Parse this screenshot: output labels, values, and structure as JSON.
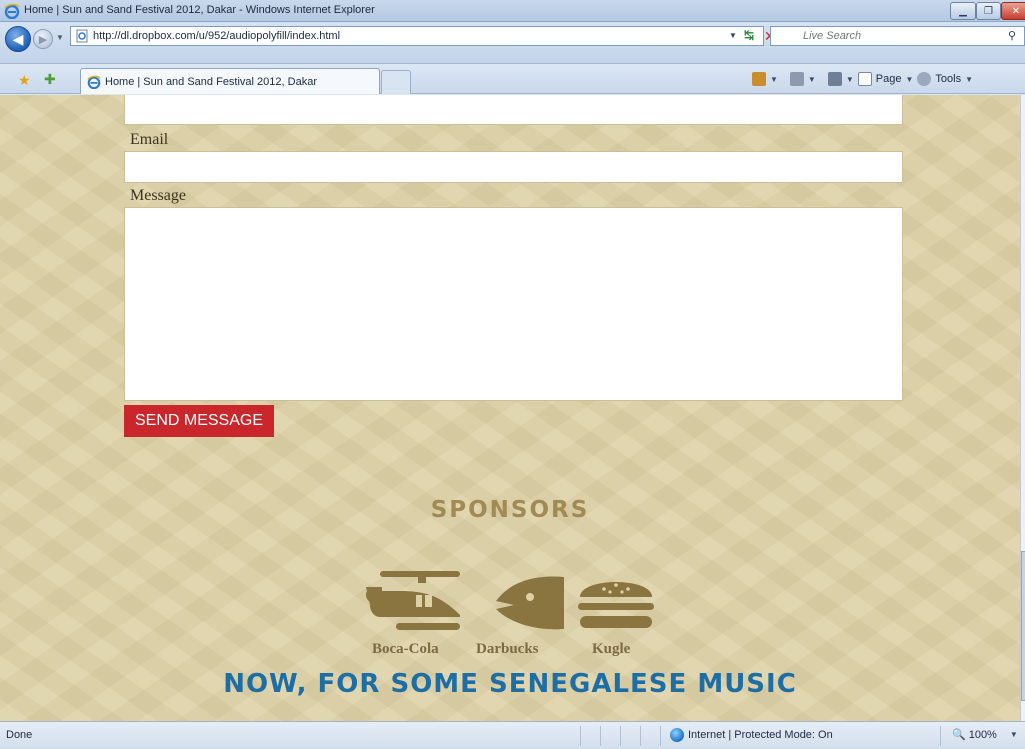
{
  "window": {
    "title": "Home | Sun and Sand Festival 2012, Dakar - Windows Internet Explorer"
  },
  "address_bar": {
    "url": "http://dl.dropbox.com/u/952/audiopolyfill/index.html",
    "search_placeholder": "Live Search"
  },
  "tabs": [
    {
      "label": "Home | Sun and Sand Festival 2012, Dakar"
    }
  ],
  "command_bar": {
    "page_label": "Page",
    "tools_label": "Tools"
  },
  "form": {
    "email_label": "Email",
    "message_label": "Message",
    "send_button_label": "SEND MESSAGE"
  },
  "sponsors": {
    "heading": "SPONSORS",
    "items": [
      {
        "name": "Boca-Cola",
        "icon": "helicopter-icon"
      },
      {
        "name": "Darbucks",
        "icon": "fish-icon"
      },
      {
        "name": "Kugle",
        "icon": "burger-icon"
      }
    ]
  },
  "music_heading": "NOW, FOR SOME SENEGALESE MUSIC",
  "status_bar": {
    "status": "Done",
    "zone": "Internet | Protected Mode: On",
    "zoom": "100%"
  },
  "colors": {
    "page_background": "#ddd1a6",
    "send_button": "#c9272c",
    "sponsor_icon": "#8a7440",
    "sponsors_heading": "#a28a55",
    "music_heading": "#1d6ea5"
  }
}
